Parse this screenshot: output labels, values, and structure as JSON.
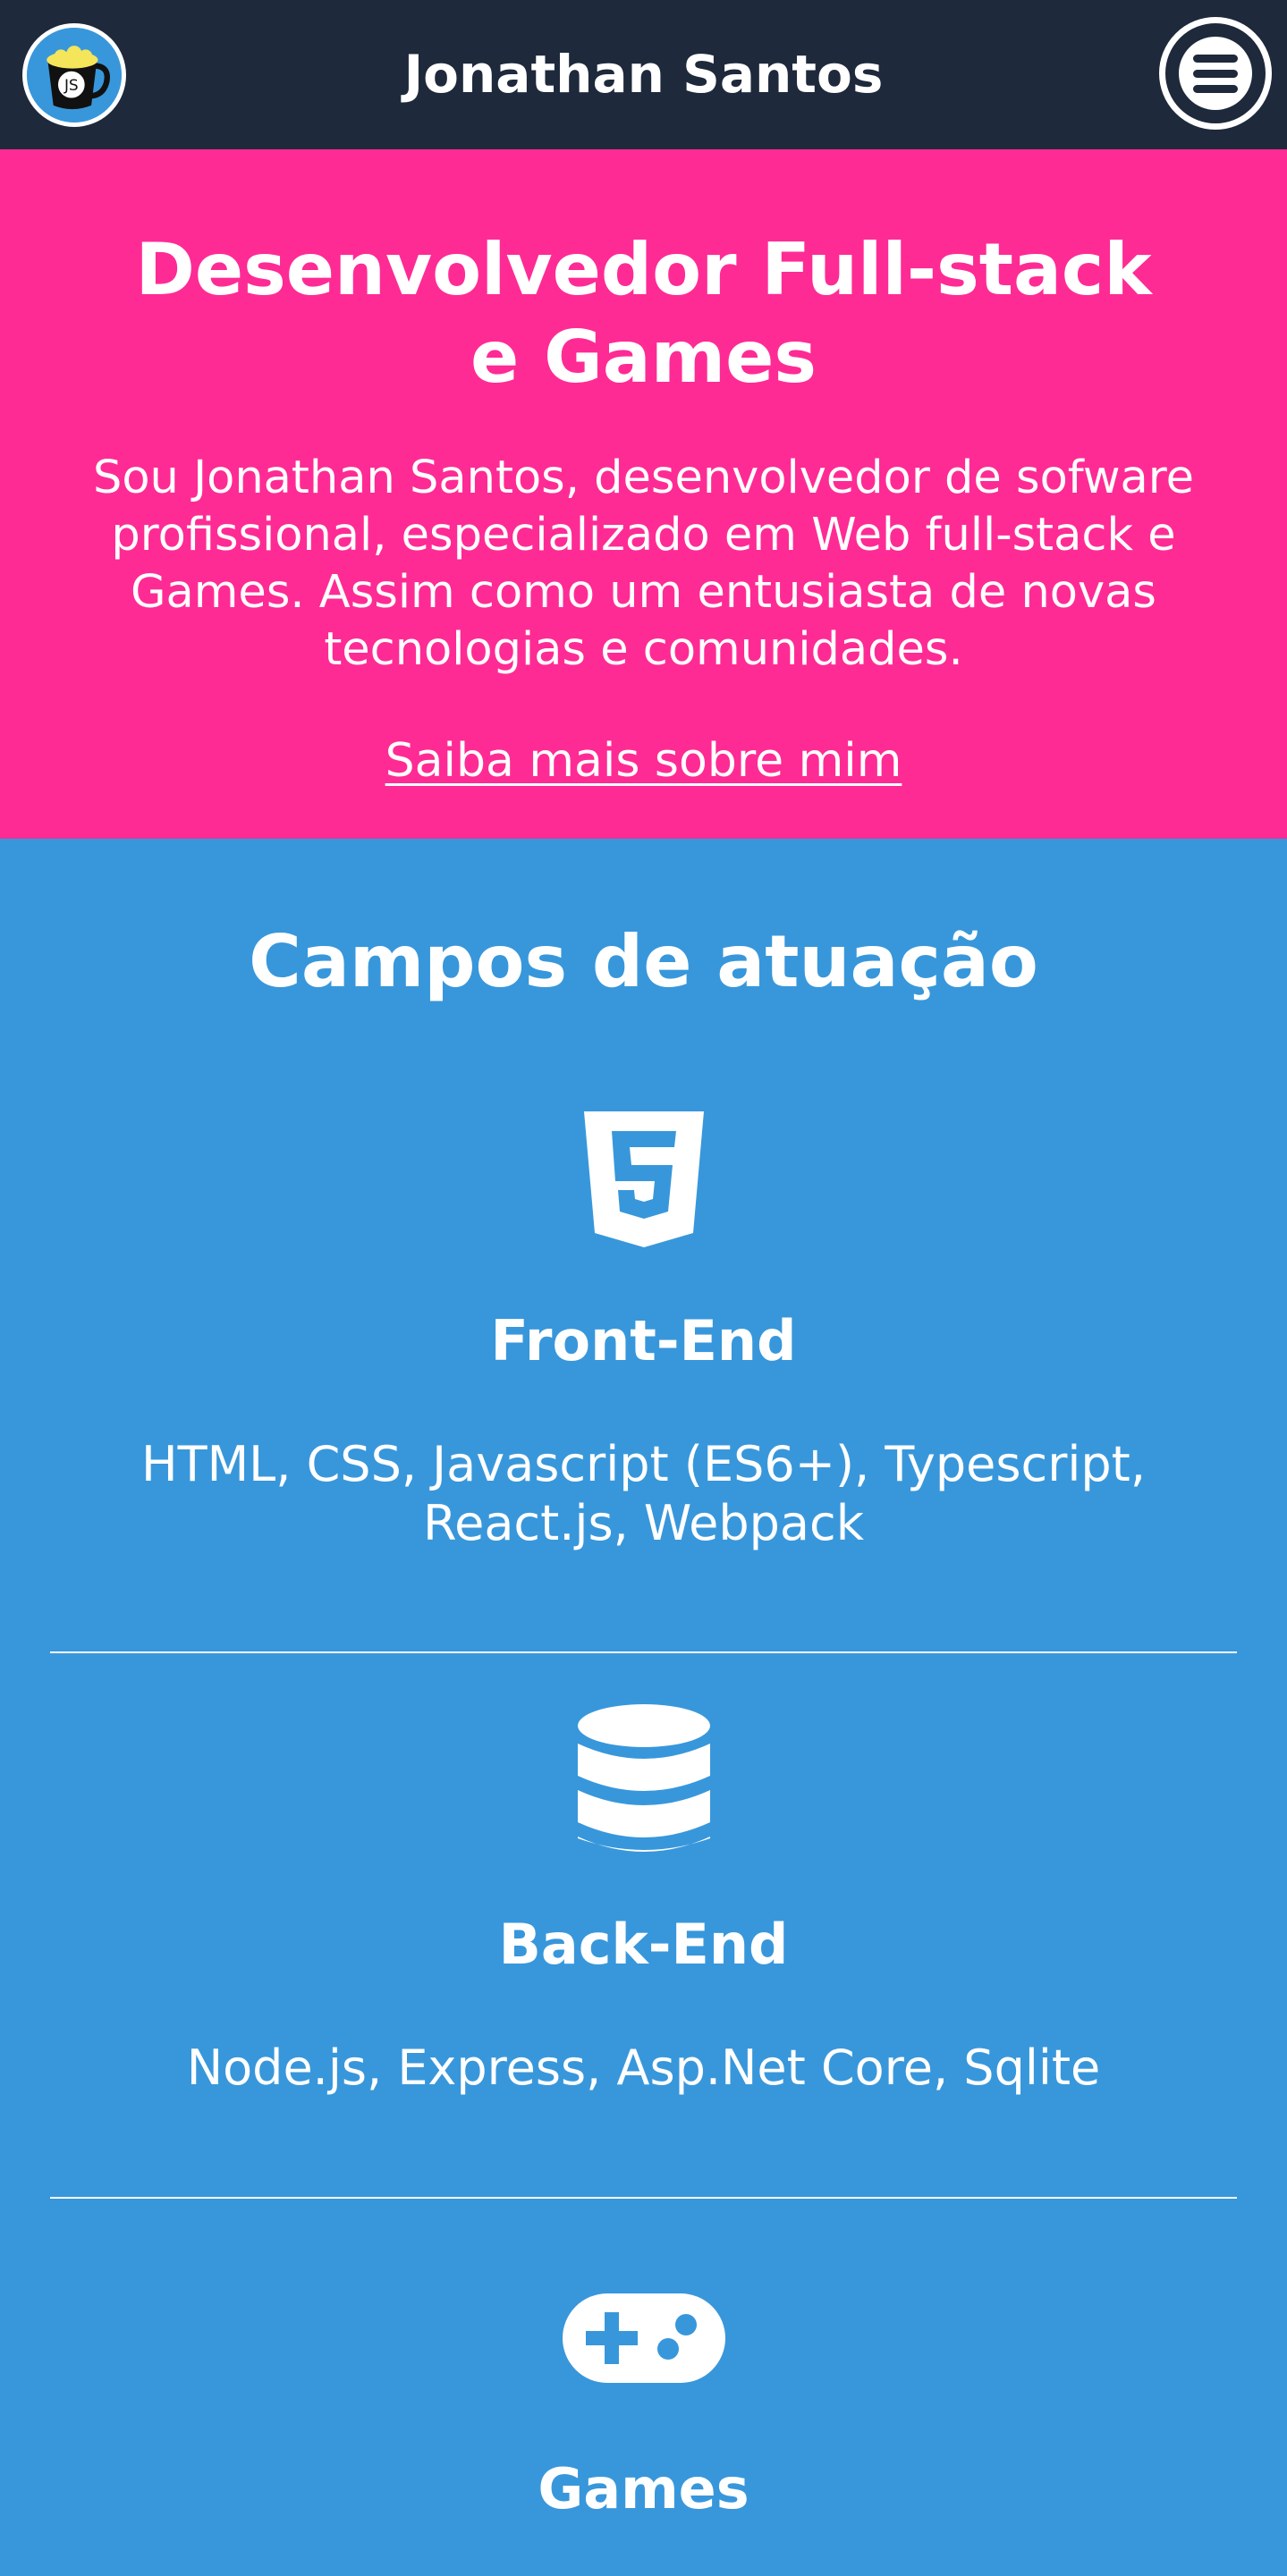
{
  "header": {
    "title": "Jonathan Santos",
    "logo_text": "JS",
    "bg_color": "#1e293b"
  },
  "hero": {
    "title": "Desenvolvedor Full-stack e Games",
    "text": "Sou Jonathan Santos, desenvolvedor de sofware profissional, especializado em Web full-stack e Games. Assim como um entusiasta de novas tecnologias e comunidades.",
    "link_label": "Saiba mais sobre mim",
    "bg_color": "#fe2b95"
  },
  "fields": {
    "title": "Campos de atuação",
    "bg_color": "#3897db",
    "items": [
      {
        "icon": "html5-icon",
        "name": "Front-End",
        "description": "HTML, CSS, Javascript (ES6+), Typescript, React.js, Webpack"
      },
      {
        "icon": "database-icon",
        "name": "Back-End",
        "description": "Node.js, Express, Asp.Net Core, Sqlite"
      },
      {
        "icon": "gamepad-icon",
        "name": "Games"
      }
    ]
  }
}
